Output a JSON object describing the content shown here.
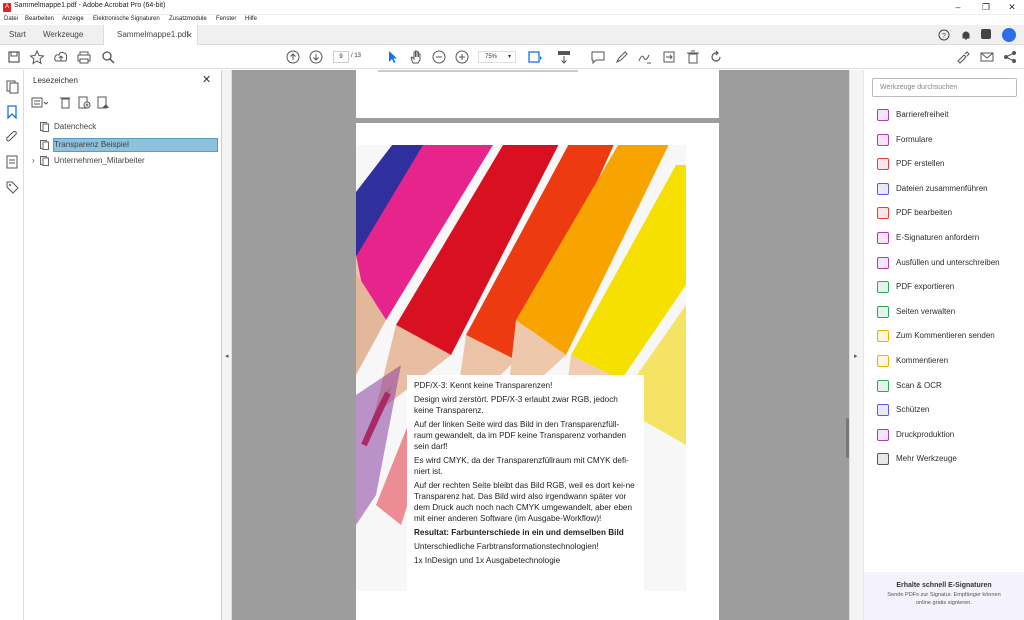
{
  "window": {
    "title": "Sammelmappe1.pdf - Adobe Acrobat Pro (64-bit)"
  },
  "menu": [
    "Datei",
    "Bearbeiten",
    "Anzeige",
    "Elektronische Signaturen",
    "Zusatzmodule",
    "Fenster",
    "Hilfe"
  ],
  "tabs": {
    "start": "Start",
    "tools": "Werkzeuge",
    "document": "Sammelmappe1.pdf"
  },
  "toolbar": {
    "current_page": "9",
    "page_total": "/ 13",
    "zoom": "75%"
  },
  "bookmarks": {
    "title": "Lesezeichen",
    "items": [
      "Datencheck",
      "Transparenz Beispiel",
      "Unternehmen_Mitarbeiter"
    ]
  },
  "document_text": {
    "p1": "PDF/X-3: Kennt keine Transparenzen!",
    "p2": "Design wird zerstört. PDF/X-3 erlaubt zwar RGB, jedoch keine Transparenz.",
    "p3": "Auf der linken Seite wird das Bild in den Transparenzfüll-raum gewandelt,  da im PDF keine Transparenz vorhanden sein darf!",
    "p4": "Es wird CMYK, da der Transparenzfüllraum mit CMYK defi-niert ist.",
    "p5": "Auf der rechten Seite bleibt das Bild RGB, weil es dort kei-ne Transparenz hat. Das Bild wird also irgendwann später vor dem Druck auch noch nach CMYK umgewandelt, aber eben mit einer anderen Software (im Ausgabe-Workflow)!",
    "p6": "Resultat: Farbunterschiede in ein und demselben Bild",
    "p7": " Unterschiedliche Farbtransformationstechnologien!",
    "p8": "1x InDesign und 1x Ausgabetechnologie"
  },
  "tools_panel": {
    "search_placeholder": "Werkzeuge durchsuchen",
    "tools": [
      {
        "label": "Barrierefreiheit",
        "color": "#b23ab2"
      },
      {
        "label": "Formulare",
        "color": "#b23ab2"
      },
      {
        "label": "PDF erstellen",
        "color": "#e0413b"
      },
      {
        "label": "Dateien zusammenführen",
        "color": "#5a5ae6"
      },
      {
        "label": "PDF bearbeiten",
        "color": "#e0413b"
      },
      {
        "label": "E-Signaturen anfordern",
        "color": "#b23ab2"
      },
      {
        "label": "Ausfüllen und unterschreiben",
        "color": "#b23ab2"
      },
      {
        "label": "PDF exportieren",
        "color": "#2ea65a"
      },
      {
        "label": "Seiten verwalten",
        "color": "#2ea65a"
      },
      {
        "label": "Zum Kommentieren senden",
        "color": "#e6b800"
      },
      {
        "label": "Kommentieren",
        "color": "#e6b800"
      },
      {
        "label": "Scan & OCR",
        "color": "#2ea65a"
      },
      {
        "label": "Schützen",
        "color": "#5a5ae6"
      },
      {
        "label": "Druckproduktion",
        "color": "#b23ab2"
      },
      {
        "label": "Mehr Werkzeuge",
        "color": "#555555"
      }
    ],
    "promo_title": "Erhalte schnell E-Signaturen",
    "promo_text": "Sende PDFs zur Signatur. Empfänger können online gratis signieren."
  }
}
